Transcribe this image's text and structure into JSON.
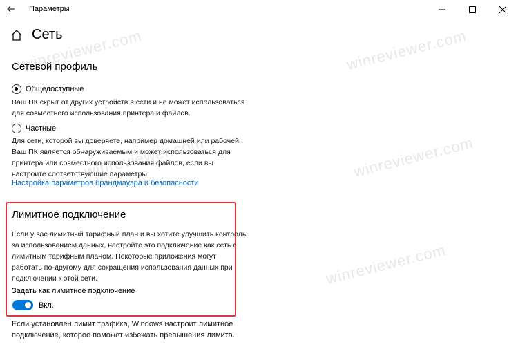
{
  "window": {
    "title": "Параметры",
    "icons": {
      "back": "back-arrow-icon",
      "minimize": "minimize-icon",
      "maximize": "maximize-icon",
      "close": "close-icon"
    }
  },
  "page": {
    "title": "Сеть",
    "home_icon": "home-icon"
  },
  "network_profile": {
    "heading": "Сетевой профиль",
    "options": [
      {
        "label": "Общедоступные",
        "selected": true,
        "description": [
          "Ваш ПК скрыт от других устройств в сети и не может использоваться",
          "для совместного использования принтера и файлов."
        ]
      },
      {
        "label": "Частные",
        "selected": false,
        "description": [
          "Для сети, которой вы доверяете, например домашней или рабочей.",
          "Ваш ПК является обнаруживаемым и может использоваться для",
          "принтера или совместного использования файлов, если вы",
          "настроите соответствующие параметры"
        ]
      }
    ],
    "firewall_link": "Настройка параметров брандмауэра и безопасности"
  },
  "metered": {
    "heading": "Лимитное подключение",
    "description": [
      "Если у вас лимитный тарифный план и вы хотите улучшить контроль",
      "за использованием данных, настройте это подключение как сеть с",
      "лимитным тарифным планом. Некоторые приложения могут",
      "работать по-другому для сокращения использования данных при",
      "подключении к этой сети."
    ],
    "toggle_label": "Задать как лимитное подключение",
    "toggle_state": "Вкл.",
    "toggle_on": true,
    "highlight_color": "#e0333d"
  },
  "footer": {
    "description": [
      "Если установлен лимит трафика, Windows настроит лимитное",
      "подключение, которое поможет избежать превышения лимита."
    ]
  },
  "watermark": "winreviewer.com",
  "colors": {
    "accent": "#0078d7",
    "link": "#0067c0"
  }
}
